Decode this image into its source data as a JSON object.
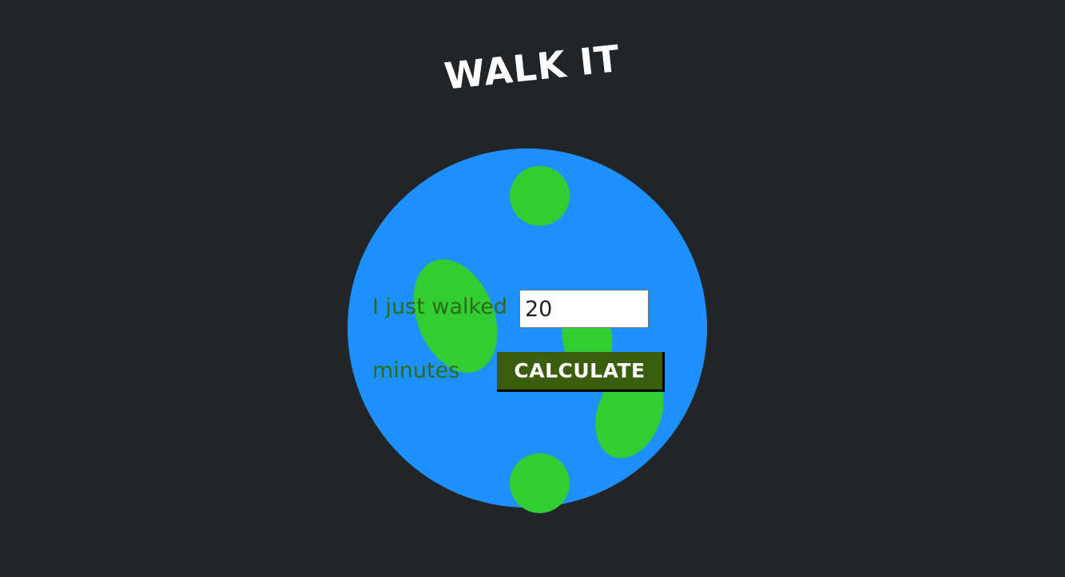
{
  "title": "WALK IT",
  "form": {
    "walked_label": "I just walked",
    "minutes_value": "20",
    "minutes_label": "minutes",
    "calculate_label": "CALCULATE"
  },
  "colors": {
    "background": "#222528",
    "ocean": "#1e90ff",
    "land": "#32cd32",
    "label_text": "#2e6b15",
    "button": "#3b5e0e"
  }
}
